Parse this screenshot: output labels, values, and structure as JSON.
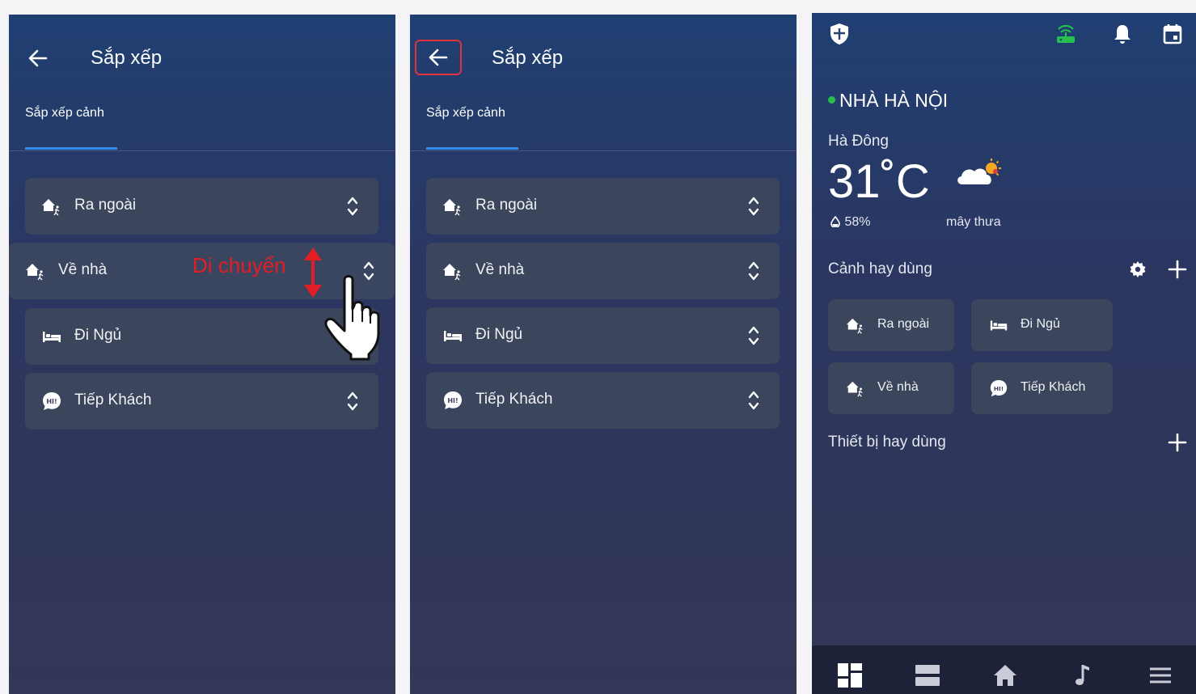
{
  "screen1": {
    "title": "Sắp xếp",
    "tab_label": "Sắp xếp cảnh",
    "drag_hint": "Di chuyển",
    "scenes": [
      {
        "label": "Ra ngoài",
        "icon": "leave-home-icon"
      },
      {
        "label": "Về nhà",
        "icon": "return-home-icon"
      },
      {
        "label": "Đi Ngủ",
        "icon": "bed-icon"
      },
      {
        "label": "Tiếp Khách",
        "icon": "hi-bubble-icon"
      }
    ]
  },
  "screen2": {
    "title": "Sắp xếp",
    "tab_label": "Sắp xếp cảnh",
    "scenes": [
      {
        "label": "Ra ngoài",
        "icon": "leave-home-icon"
      },
      {
        "label": "Về nhà",
        "icon": "return-home-icon"
      },
      {
        "label": "Đi Ngủ",
        "icon": "bed-icon"
      },
      {
        "label": "Tiếp Khách",
        "icon": "hi-bubble-icon"
      }
    ]
  },
  "screen3": {
    "home_name": "NHÀ HÀ NỘI",
    "location": "Hà Đông",
    "temperature": "31˚C",
    "humidity": "58%",
    "condition": "mây thưa",
    "favorite_scenes_title": "Cảnh hay dùng",
    "favorite_scenes": [
      {
        "label": "Ra ngoài",
        "icon": "leave-home-icon"
      },
      {
        "label": "Đi Ngủ",
        "icon": "bed-icon"
      },
      {
        "label": "Về nhà",
        "icon": "return-home-icon"
      },
      {
        "label": "Tiếp Khách",
        "icon": "hi-bubble-icon"
      }
    ],
    "favorite_devices_title": "Thiết bị hay dùng",
    "top_icons": [
      "shield-icon",
      "router-icon",
      "bell-icon",
      "calendar-icon"
    ],
    "nav_icons": [
      "dashboard-icon",
      "rooms-icon",
      "home-icon",
      "music-icon",
      "menu-icon"
    ]
  },
  "colors": {
    "accent": "#2f8fe8",
    "highlight": "#e0313c",
    "online": "#27c04f",
    "router": "#27c04f"
  }
}
